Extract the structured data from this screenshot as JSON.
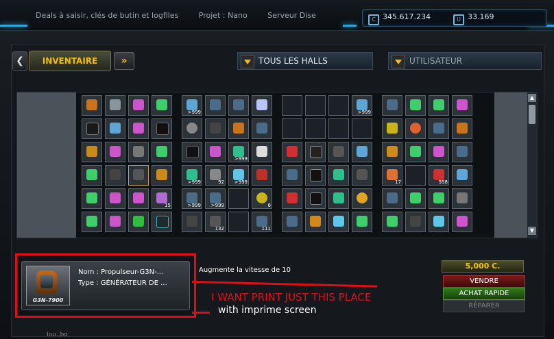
{
  "topbar": {
    "ticker": [
      "Deals à saisir, clés de butin et logfiles",
      "Projet : Nano",
      "Serveur Dise"
    ],
    "credits": "345.617.234",
    "uridium": "33.169",
    "credits_icon": "credits-icon",
    "uridium_icon": "uridium-icon"
  },
  "nav": {
    "tab_label": "INVENTAIRE",
    "prev_arrow": "❮",
    "next_arrow": "»",
    "halls_label": "TOUS LES HALLS",
    "user_label": "UTILISATEUR"
  },
  "grid": {
    "quantities": {
      "c1": ">999",
      "c2": ">999",
      "c3": ">999",
      "c4": "92",
      "c5": ">999",
      "c6": ">999",
      "c7": "15",
      "c8": ">999",
      "c9": "6",
      "c10": "132",
      "c11": "111",
      "c12": "17",
      "c13": "958",
      "c14": ">999"
    }
  },
  "item": {
    "thumb_label": "G3N-7900",
    "name_label": "Nom : Propulseur-G3N-...",
    "type_label": "Type : GÉNÉRATEUR DE ...",
    "description": "Augmente la vitesse de 10"
  },
  "actions": {
    "price": "5,000 C.",
    "sell": "VENDRE",
    "quick_buy": "ACHAT RAPIDE",
    "repair": "RÉPARER"
  },
  "annotation": {
    "main": "I WANT PRINT JUST THIS PLACE",
    "sub": "with imprime screen"
  },
  "footer": "Iou..bo"
}
